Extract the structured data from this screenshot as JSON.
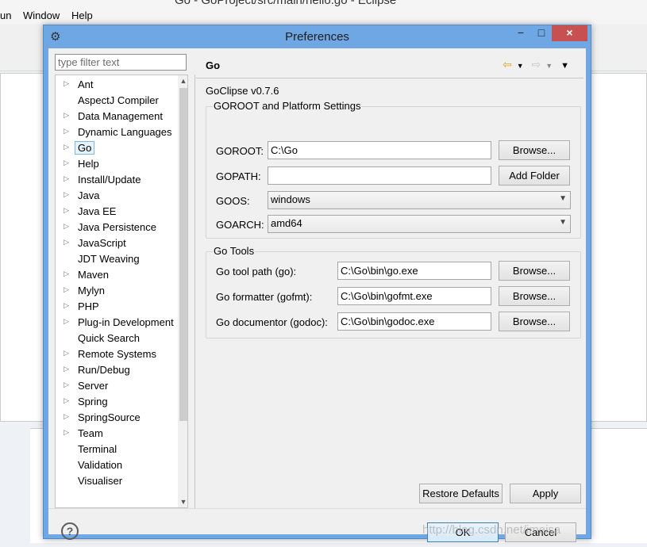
{
  "background_window": {
    "title": "Go - GoProject/src/main/hello.go - Eclipse",
    "menu": [
      "un",
      "Window",
      "Help"
    ]
  },
  "dialog": {
    "title": "Preferences",
    "window_controls": {
      "minimize": "−",
      "maximize": "□",
      "close": "×"
    }
  },
  "filter": {
    "placeholder": "type filter text"
  },
  "tree": {
    "items": [
      {
        "label": "Ant",
        "expandable": true
      },
      {
        "label": "AspectJ Compiler",
        "expandable": false
      },
      {
        "label": "Data Management",
        "expandable": true
      },
      {
        "label": "Dynamic Languages",
        "expandable": true
      },
      {
        "label": "Go",
        "expandable": true,
        "selected": true
      },
      {
        "label": "Help",
        "expandable": true
      },
      {
        "label": "Install/Update",
        "expandable": true
      },
      {
        "label": "Java",
        "expandable": true
      },
      {
        "label": "Java EE",
        "expandable": true
      },
      {
        "label": "Java Persistence",
        "expandable": true
      },
      {
        "label": "JavaScript",
        "expandable": true
      },
      {
        "label": "JDT Weaving",
        "expandable": false
      },
      {
        "label": "Maven",
        "expandable": true
      },
      {
        "label": "Mylyn",
        "expandable": true
      },
      {
        "label": "PHP",
        "expandable": true
      },
      {
        "label": "Plug-in Development",
        "expandable": true
      },
      {
        "label": "Quick Search",
        "expandable": false
      },
      {
        "label": "Remote Systems",
        "expandable": true
      },
      {
        "label": "Run/Debug",
        "expandable": true
      },
      {
        "label": "Server",
        "expandable": true
      },
      {
        "label": "Spring",
        "expandable": true
      },
      {
        "label": "SpringSource",
        "expandable": true
      },
      {
        "label": "Team",
        "expandable": true
      },
      {
        "label": "Terminal",
        "expandable": false
      },
      {
        "label": "Validation",
        "expandable": false
      },
      {
        "label": "Visualiser",
        "expandable": false
      }
    ]
  },
  "page": {
    "title": "Go",
    "version": "GoClipse v0.7.6",
    "goroot_group": {
      "title": "GOROOT and Platform Settings",
      "goroot_label": "GOROOT:",
      "goroot_value": "C:\\Go",
      "goroot_browse": "Browse...",
      "gopath_label": "GOPATH:",
      "gopath_value": "",
      "gopath_add": "Add Folder",
      "goos_label": "GOOS:",
      "goos_value": "windows",
      "goarch_label": "GOARCH:",
      "goarch_value": "amd64"
    },
    "tools_group": {
      "title": "Go Tools",
      "go_label": "Go tool path (go):",
      "go_value": "C:\\Go\\bin\\go.exe",
      "gofmt_label": "Go formatter (gofmt):",
      "gofmt_value": "C:\\Go\\bin\\gofmt.exe",
      "godoc_label": "Go documentor (godoc):",
      "godoc_value": "C:\\Go\\bin\\godoc.exe",
      "browse": "Browse..."
    },
    "restore_defaults": "Restore Defaults",
    "apply": "Apply"
  },
  "footer": {
    "help": "?",
    "ok": "OK",
    "cancel": "Cancel"
  },
  "watermark": "http://blog.csdn.net/imeisa"
}
